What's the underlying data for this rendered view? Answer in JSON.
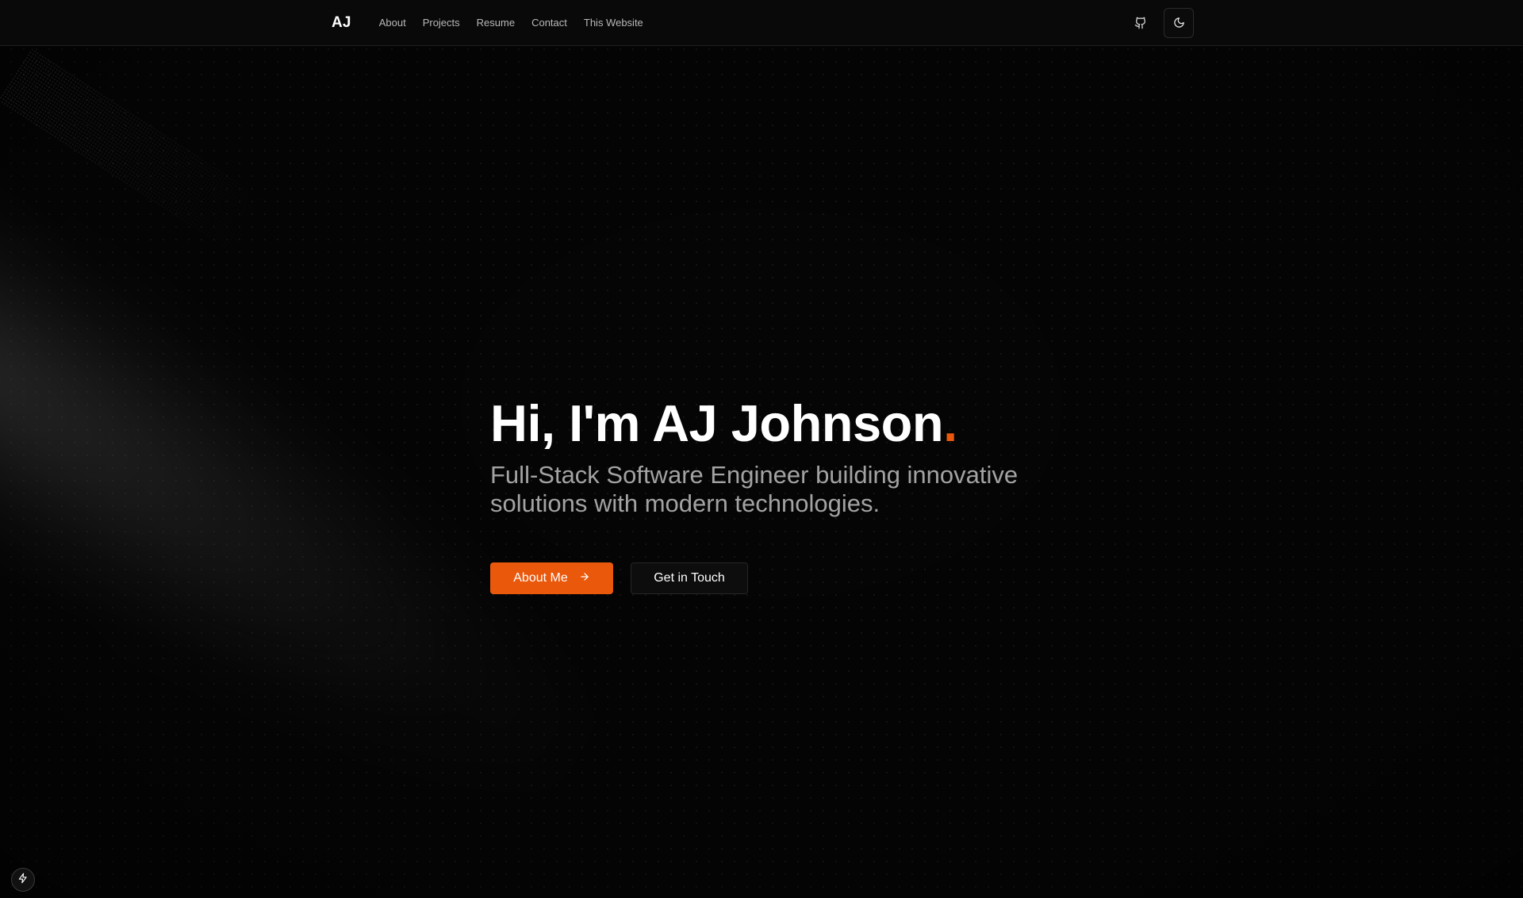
{
  "nav": {
    "brand": "AJ",
    "links": [
      {
        "label": "About"
      },
      {
        "label": "Projects"
      },
      {
        "label": "Resume"
      },
      {
        "label": "Contact"
      },
      {
        "label": "This Website"
      }
    ],
    "icons": {
      "github": "github-icon",
      "theme_toggle": "moon-icon"
    }
  },
  "hero": {
    "title": "Hi, I'm AJ Johnson",
    "title_dot": ".",
    "subtitle": "Full-Stack Software Engineer building innovative solutions with modern technologies.",
    "primary_button": "About Me",
    "primary_button_icon": "arrow-right-icon",
    "secondary_button": "Get in Touch"
  },
  "badge": {
    "icon": "lightning-icon"
  },
  "colors": {
    "accent": "#ea580c",
    "background": "#050505",
    "muted_text": "#a3a3a3",
    "nav_text": "#b8b8b8"
  }
}
